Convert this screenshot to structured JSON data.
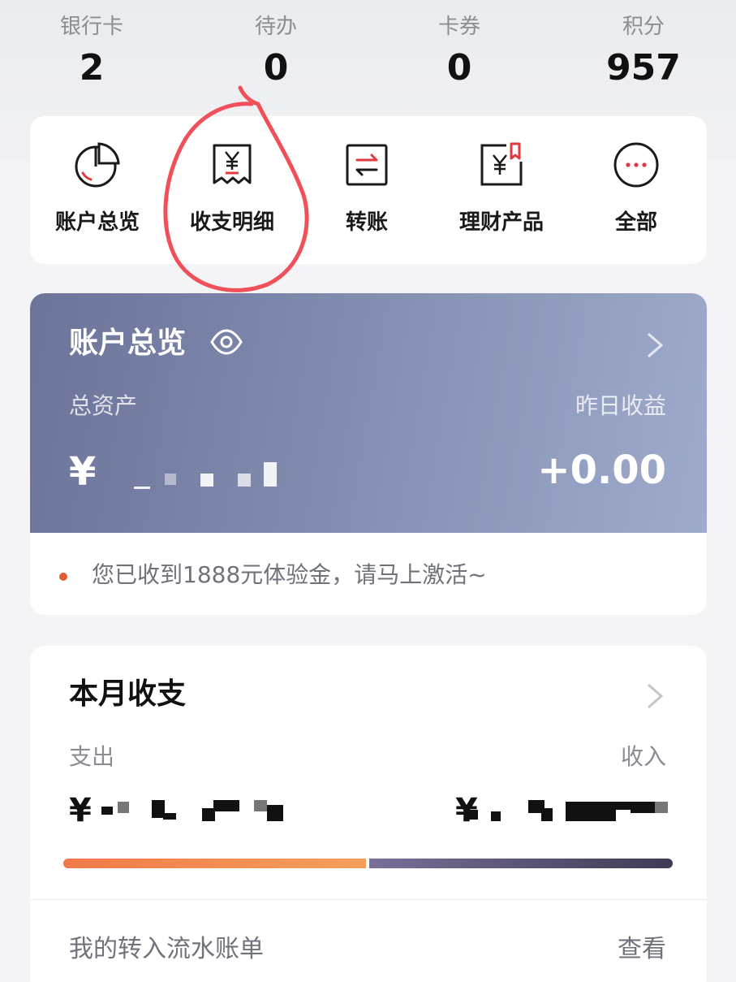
{
  "stats": [
    {
      "label": "银行卡",
      "value": "2"
    },
    {
      "label": "待办",
      "value": "0"
    },
    {
      "label": "卡券",
      "value": "0"
    },
    {
      "label": "积分",
      "value": "957"
    }
  ],
  "quick_actions": [
    {
      "label": "账户总览",
      "icon": "pie-chart-icon"
    },
    {
      "label": "收支明细",
      "icon": "receipt-icon"
    },
    {
      "label": "转账",
      "icon": "transfer-icon"
    },
    {
      "label": "理财产品",
      "icon": "wealth-product-icon"
    },
    {
      "label": "全部",
      "icon": "more-icon"
    }
  ],
  "account": {
    "title": "账户总览",
    "total_label": "总资产",
    "total_prefix": "¥",
    "yesterday_label": "昨日收益",
    "yesterday_value": "+0.00",
    "notice": "您已收到1888元体验金，请马上激活~"
  },
  "monthly": {
    "title": "本月收支",
    "out_label": "支出",
    "in_label": "收入",
    "currency": "¥",
    "statement_label": "我的转入流水账单",
    "view_label": "查看"
  },
  "colors": {
    "accent_red": "#e0393e",
    "card_gradient_start": "#6c7499",
    "card_gradient_end": "#9fabcb",
    "out_bar": "#f07a4a",
    "in_bar": "#4a4462",
    "notice_dot": "#e05a32"
  }
}
